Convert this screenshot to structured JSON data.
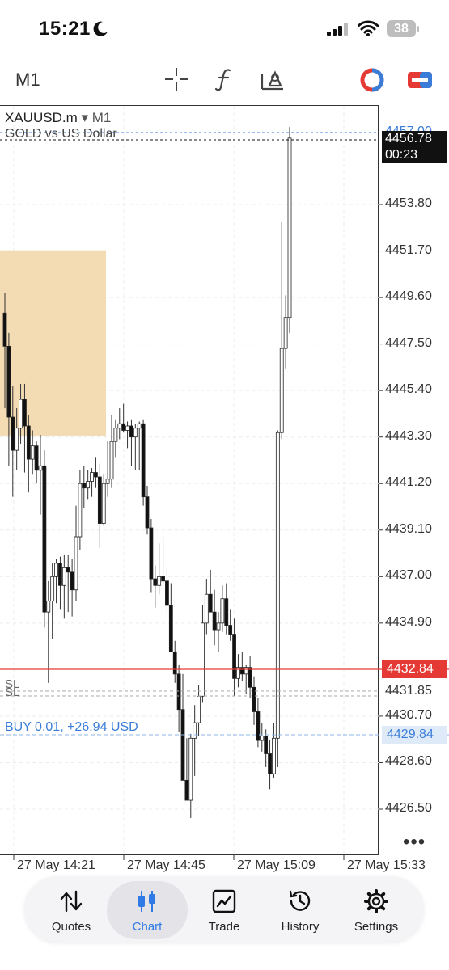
{
  "status_bar": {
    "time": "15:21",
    "battery": "38"
  },
  "toolbar": {
    "timeframe": "M1"
  },
  "chart": {
    "symbol": "XAUUSD.m",
    "timeframe": "▾ M1",
    "description": "GOLD vs US Dollar",
    "last_price": "4456.78",
    "countdown": "00:23",
    "top_partial": "4457.00",
    "current_line_price": "4432.84",
    "sl_price": "4431.85",
    "buy_price": "4429.84",
    "sl_label_1": "SL",
    "sl_label_2": "SL",
    "buy_label": "BUY 0.01, +26.94 USD",
    "more": "•••",
    "price_ticks": [
      "4453.80",
      "4451.70",
      "4449.60",
      "4447.50",
      "4445.40",
      "4443.30",
      "4441.20",
      "4439.10",
      "4437.00",
      "4434.90",
      "4430.70",
      "4428.60",
      "4426.50"
    ],
    "time_ticks": [
      "27 May 14:21",
      "27 May 14:45",
      "27 May 15:09",
      "27 May 15:33"
    ],
    "colors": {
      "red_line": "#e53935",
      "blue_line": "#3a7dd8",
      "zone": "#f2d9b0"
    }
  },
  "chart_data": {
    "type": "candlestick",
    "x_ticks": [
      "27 May 14:21",
      "27 May 14:45",
      "27 May 15:09",
      "27 May 15:33"
    ],
    "ylim": [
      4425.5,
      4458.0
    ],
    "candles": [
      {
        "o": 4448.9,
        "h": 4449.8,
        "l": 4444.6,
        "c": 4447.4
      },
      {
        "o": 4447.4,
        "h": 4448.0,
        "l": 4442.0,
        "c": 4444.2
      },
      {
        "o": 4444.2,
        "h": 4445.6,
        "l": 4440.6,
        "c": 4442.7
      },
      {
        "o": 4442.7,
        "h": 4444.6,
        "l": 4441.8,
        "c": 4443.7
      },
      {
        "o": 4443.7,
        "h": 4445.7,
        "l": 4443.0,
        "c": 4445.0
      },
      {
        "o": 4445.0,
        "h": 4445.7,
        "l": 4441.7,
        "c": 4443.8
      },
      {
        "o": 4443.8,
        "h": 4444.3,
        "l": 4440.8,
        "c": 4442.3
      },
      {
        "o": 4442.3,
        "h": 4443.6,
        "l": 4441.6,
        "c": 4442.9
      },
      {
        "o": 4442.9,
        "h": 4443.1,
        "l": 4441.2,
        "c": 4441.8
      },
      {
        "o": 4441.8,
        "h": 4443.4,
        "l": 4439.8,
        "c": 4442.0
      },
      {
        "o": 4442.0,
        "h": 4442.7,
        "l": 4434.7,
        "c": 4435.4
      },
      {
        "o": 4435.4,
        "h": 4436.8,
        "l": 4432.2,
        "c": 4435.9
      },
      {
        "o": 4435.9,
        "h": 4437.6,
        "l": 4434.2,
        "c": 4437.0
      },
      {
        "o": 4437.0,
        "h": 4437.8,
        "l": 4435.8,
        "c": 4437.6
      },
      {
        "o": 4437.6,
        "h": 4437.9,
        "l": 4435.5,
        "c": 4436.6
      },
      {
        "o": 4436.6,
        "h": 4438.0,
        "l": 4435.1,
        "c": 4437.4
      },
      {
        "o": 4437.4,
        "h": 4438.0,
        "l": 4435.4,
        "c": 4437.2
      },
      {
        "o": 4437.2,
        "h": 4437.8,
        "l": 4435.2,
        "c": 4436.4
      },
      {
        "o": 4436.4,
        "h": 4440.2,
        "l": 4435.9,
        "c": 4438.8
      },
      {
        "o": 4438.8,
        "h": 4441.8,
        "l": 4438.2,
        "c": 4441.2
      },
      {
        "o": 4441.2,
        "h": 4442.0,
        "l": 4440.1,
        "c": 4441.0
      },
      {
        "o": 4441.0,
        "h": 4441.8,
        "l": 4440.5,
        "c": 4441.3
      },
      {
        "o": 4441.3,
        "h": 4441.9,
        "l": 4440.6,
        "c": 4441.7
      },
      {
        "o": 4441.7,
        "h": 4442.4,
        "l": 4441.0,
        "c": 4441.5
      },
      {
        "o": 4441.5,
        "h": 4442.1,
        "l": 4438.3,
        "c": 4439.4
      },
      {
        "o": 4439.4,
        "h": 4441.6,
        "l": 4439.3,
        "c": 4441.2
      },
      {
        "o": 4441.2,
        "h": 4443.1,
        "l": 4440.6,
        "c": 4441.4
      },
      {
        "o": 4441.4,
        "h": 4444.3,
        "l": 4441.0,
        "c": 4443.1
      },
      {
        "o": 4443.1,
        "h": 4444.1,
        "l": 4442.4,
        "c": 4443.7
      },
      {
        "o": 4443.7,
        "h": 4444.6,
        "l": 4443.2,
        "c": 4443.9
      },
      {
        "o": 4443.9,
        "h": 4444.8,
        "l": 4443.5,
        "c": 4443.6
      },
      {
        "o": 4443.6,
        "h": 4444.0,
        "l": 4442.8,
        "c": 4443.8
      },
      {
        "o": 4443.8,
        "h": 4444.1,
        "l": 4442.0,
        "c": 4443.3
      },
      {
        "o": 4443.3,
        "h": 4443.9,
        "l": 4441.8,
        "c": 4443.7
      },
      {
        "o": 4443.7,
        "h": 4444.0,
        "l": 4441.8,
        "c": 4443.9
      },
      {
        "o": 4443.9,
        "h": 4444.1,
        "l": 4440.2,
        "c": 4440.6
      },
      {
        "o": 4440.6,
        "h": 4441.1,
        "l": 4438.9,
        "c": 4439.2
      },
      {
        "o": 4439.2,
        "h": 4439.6,
        "l": 4436.3,
        "c": 4436.9
      },
      {
        "o": 4436.9,
        "h": 4437.5,
        "l": 4435.6,
        "c": 4436.6
      },
      {
        "o": 4436.6,
        "h": 4438.5,
        "l": 4436.2,
        "c": 4437.0
      },
      {
        "o": 4437.0,
        "h": 4438.8,
        "l": 4436.7,
        "c": 4436.8
      },
      {
        "o": 4436.8,
        "h": 4437.4,
        "l": 4435.4,
        "c": 4435.7
      },
      {
        "o": 4435.7,
        "h": 4436.7,
        "l": 4433.9,
        "c": 4433.6
      },
      {
        "o": 4433.6,
        "h": 4434.1,
        "l": 4432.2,
        "c": 4432.6
      },
      {
        "o": 4432.6,
        "h": 4433.0,
        "l": 4430.0,
        "c": 4431.0
      },
      {
        "o": 4431.0,
        "h": 4432.6,
        "l": 4429.8,
        "c": 4427.8
      },
      {
        "o": 4427.8,
        "h": 4429.7,
        "l": 4427.3,
        "c": 4426.9
      },
      {
        "o": 4426.9,
        "h": 4429.9,
        "l": 4426.1,
        "c": 4429.7
      },
      {
        "o": 4429.7,
        "h": 4431.2,
        "l": 4428.0,
        "c": 4430.4
      },
      {
        "o": 4430.4,
        "h": 4432.1,
        "l": 4429.8,
        "c": 4431.6
      },
      {
        "o": 4431.6,
        "h": 4435.7,
        "l": 4431.3,
        "c": 4434.9
      },
      {
        "o": 4434.9,
        "h": 4436.9,
        "l": 4434.4,
        "c": 4436.2
      },
      {
        "o": 4436.2,
        "h": 4437.3,
        "l": 4435.7,
        "c": 4435.4
      },
      {
        "o": 4435.4,
        "h": 4436.4,
        "l": 4433.9,
        "c": 4434.6
      },
      {
        "o": 4434.6,
        "h": 4435.4,
        "l": 4433.6,
        "c": 4434.9
      },
      {
        "o": 4434.9,
        "h": 4436.6,
        "l": 4434.5,
        "c": 4436.0
      },
      {
        "o": 4436.0,
        "h": 4436.7,
        "l": 4434.4,
        "c": 4434.8
      },
      {
        "o": 4434.8,
        "h": 4435.5,
        "l": 4434.1,
        "c": 4434.4
      },
      {
        "o": 4434.4,
        "h": 4435.1,
        "l": 4431.6,
        "c": 4432.4
      },
      {
        "o": 4432.4,
        "h": 4433.5,
        "l": 4432.0,
        "c": 4432.9
      },
      {
        "o": 4432.9,
        "h": 4433.6,
        "l": 4432.3,
        "c": 4432.6
      },
      {
        "o": 4432.6,
        "h": 4433.0,
        "l": 4431.7,
        "c": 4432.9
      },
      {
        "o": 4432.9,
        "h": 4433.4,
        "l": 4431.5,
        "c": 4432.0
      },
      {
        "o": 4432.0,
        "h": 4432.5,
        "l": 4430.3,
        "c": 4430.9
      },
      {
        "o": 4430.9,
        "h": 4431.5,
        "l": 4429.3,
        "c": 4429.6
      },
      {
        "o": 4429.6,
        "h": 4430.4,
        "l": 4429.1,
        "c": 4429.8
      },
      {
        "o": 4429.8,
        "h": 4430.1,
        "l": 4428.4,
        "c": 4429.0
      },
      {
        "o": 4429.0,
        "h": 4429.6,
        "l": 4427.4,
        "c": 4428.1
      },
      {
        "o": 4428.1,
        "h": 4430.4,
        "l": 4427.9,
        "c": 4429.7
      },
      {
        "o": 4429.7,
        "h": 4443.6,
        "l": 4428.4,
        "c": 4443.5
      },
      {
        "o": 4443.5,
        "h": 4453.0,
        "l": 4443.2,
        "c": 4447.3
      },
      {
        "o": 4447.3,
        "h": 4449.7,
        "l": 4446.4,
        "c": 4448.7
      },
      {
        "o": 4448.7,
        "h": 4457.3,
        "l": 4448.0,
        "c": 4456.8
      }
    ]
  },
  "nav": {
    "items": [
      {
        "label": "Quotes"
      },
      {
        "label": "Chart"
      },
      {
        "label": "Trade"
      },
      {
        "label": "History"
      },
      {
        "label": "Settings"
      }
    ]
  }
}
